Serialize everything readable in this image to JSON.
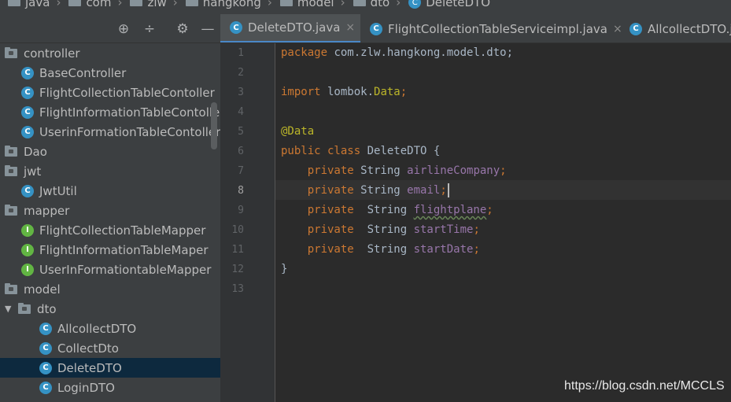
{
  "breadcrumb": [
    {
      "label": "java",
      "icon": "folder-icon"
    },
    {
      "label": "com",
      "icon": "folder-icon"
    },
    {
      "label": "zlw",
      "icon": "folder-icon"
    },
    {
      "label": "hangkong",
      "icon": "folder-icon"
    },
    {
      "label": "model",
      "icon": "folder-icon"
    },
    {
      "label": "dto",
      "icon": "folder-icon"
    },
    {
      "label": "DeleteDTO",
      "icon": "class-icon"
    }
  ],
  "toolbar": {
    "locate_icon": "⊕",
    "collapse_icon": "÷",
    "settings_icon": "⚙",
    "hide_icon": "—"
  },
  "tree": [
    {
      "label": "controller",
      "type": "folder"
    },
    {
      "label": "BaseController",
      "type": "class"
    },
    {
      "label": "FlightCollectionTableContoller",
      "type": "class"
    },
    {
      "label": "FlightInformationTableContoller",
      "type": "class"
    },
    {
      "label": "UserinFormationTableContoller",
      "type": "class"
    },
    {
      "label": "Dao",
      "type": "folder"
    },
    {
      "label": "jwt",
      "type": "folder"
    },
    {
      "label": "JwtUtil",
      "type": "class"
    },
    {
      "label": "mapper",
      "type": "folder"
    },
    {
      "label": "FlightCollectionTableMapper",
      "type": "interface"
    },
    {
      "label": "FlightInformationTableMaper",
      "type": "interface"
    },
    {
      "label": "UserInFormationtableMapper",
      "type": "interface"
    },
    {
      "label": "model",
      "type": "folder"
    },
    {
      "label": "dto",
      "type": "folder"
    },
    {
      "label": "AllcollectDTO",
      "type": "class"
    },
    {
      "label": "CollectDto",
      "type": "class"
    },
    {
      "label": "DeleteDTO",
      "type": "class"
    },
    {
      "label": "LoginDTO",
      "type": "class"
    }
  ],
  "tabs": [
    {
      "label": "DeleteDTO.java",
      "close": "×"
    },
    {
      "label": "FlightCollectionTableServiceimpl.java",
      "close": "×"
    },
    {
      "label": "AllcollectDTO.java",
      "close": ""
    }
  ],
  "line_numbers": [
    "1",
    "2",
    "3",
    "4",
    "5",
    "6",
    "7",
    "8",
    "9",
    "10",
    "11",
    "12",
    "13"
  ],
  "code": {
    "l1_kw": "package",
    "l1_rest": " com.zlw.hangkong.model.dto;",
    "l3_kw": "import",
    "l3_rest": " lombok.",
    "l3_type": "Data",
    "l3_end": ";",
    "l5": "@Data",
    "l6_kw": "public class",
    "l6_rest": " DeleteDTO {",
    "l7_kw": "    private",
    "l7_type": " String ",
    "l7_field": "airlineCompany",
    "l7_end": ";",
    "l8_kw": "    private",
    "l8_type": " String ",
    "l8_field": "email",
    "l8_end": ";",
    "l9_kw": "    private",
    "l9_type": "  String ",
    "l9_field": "flightplane",
    "l9_end": ";",
    "l10_kw": "    private",
    "l10_type": "  String ",
    "l10_field": "startTime",
    "l10_end": ";",
    "l11_kw": "    private",
    "l11_type": "  String ",
    "l11_field": "startDate",
    "l11_end": ";",
    "l12": "}"
  },
  "watermark": "https://blog.csdn.net/MCCLS",
  "colors": {
    "keyword": "#cc7832",
    "field": "#9876aa",
    "annotation": "#bbb529",
    "selection": "#0d293e",
    "tab_underline": "#4a88c7"
  }
}
